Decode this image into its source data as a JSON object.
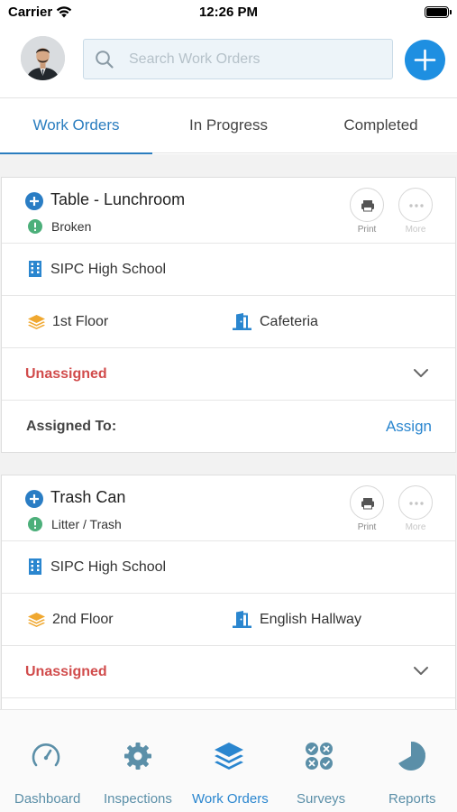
{
  "status_bar": {
    "carrier": "Carrier",
    "time": "12:26 PM"
  },
  "header": {
    "search_placeholder": "Search Work Orders",
    "add_button_icon": "plus-icon",
    "avatar_icon": "user-avatar"
  },
  "tabs": [
    {
      "label": "Work Orders",
      "active": true
    },
    {
      "label": "In Progress",
      "active": false
    },
    {
      "label": "Completed",
      "active": false
    }
  ],
  "cards": [
    {
      "title": "Table - Lunchroom",
      "status": "Broken",
      "print_label": "Print",
      "more_label": "More",
      "building": "SIPC High School",
      "floor": "1st Floor",
      "room": "Cafeteria",
      "assignment": "Unassigned",
      "assigned_to_label": "Assigned To:",
      "assign_action": "Assign"
    },
    {
      "title": "Trash Can",
      "status": "Litter / Trash",
      "print_label": "Print",
      "more_label": "More",
      "building": "SIPC High School",
      "floor": "2nd Floor",
      "room": "English Hallway",
      "assignment": "Unassigned"
    }
  ],
  "bottom_nav": [
    {
      "label": "Dashboard",
      "icon": "gauge-icon",
      "active": false
    },
    {
      "label": "Inspections",
      "icon": "gear-icon",
      "active": false
    },
    {
      "label": "Work Orders",
      "icon": "layers-icon",
      "active": true
    },
    {
      "label": "Surveys",
      "icon": "checklist-icon",
      "active": false
    },
    {
      "label": "Reports",
      "icon": "pie-chart-icon",
      "active": false
    }
  ],
  "colors": {
    "accent": "#2a86cf",
    "add_button": "#1e8fe1",
    "unassigned": "#d14c4c",
    "status_alert": "#4caf7a",
    "floor_icon": "#f0a830",
    "nav_inactive": "#5b8fa8"
  }
}
